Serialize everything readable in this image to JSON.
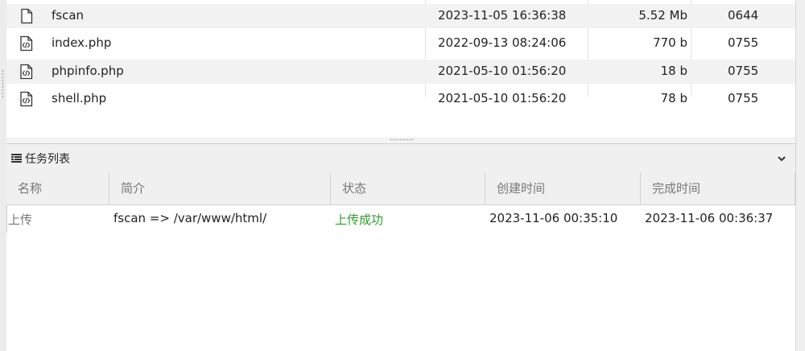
{
  "files": [
    {
      "name": "fscan",
      "date": "2023-11-05 16:36:38",
      "size": "5.52 Mb",
      "perm": "0644",
      "icon": "file-icon"
    },
    {
      "name": "index.php",
      "date": "2022-09-13 08:24:06",
      "size": "770 b",
      "perm": "0755",
      "icon": "code-file-icon"
    },
    {
      "name": "phpinfo.php",
      "date": "2021-05-10 01:56:20",
      "size": "18 b",
      "perm": "0755",
      "icon": "code-file-icon"
    },
    {
      "name": "shell.php",
      "date": "2021-05-10 01:56:20",
      "size": "78 b",
      "perm": "0755",
      "icon": "code-file-icon"
    }
  ],
  "task_panel": {
    "title": "任务列表",
    "columns": [
      "名称",
      "简介",
      "状态",
      "创建时间",
      "完成时间"
    ],
    "rows": [
      {
        "name": "上传",
        "desc": "fscan => /var/www/html/",
        "status": "上传成功",
        "created": "2023-11-06 00:35:10",
        "finished": "2023-11-06 00:36:37"
      }
    ]
  },
  "colors": {
    "status_success": "#2e9e2e",
    "row_alt": "#f2f2f2",
    "header_bg": "#f0f0f0"
  }
}
